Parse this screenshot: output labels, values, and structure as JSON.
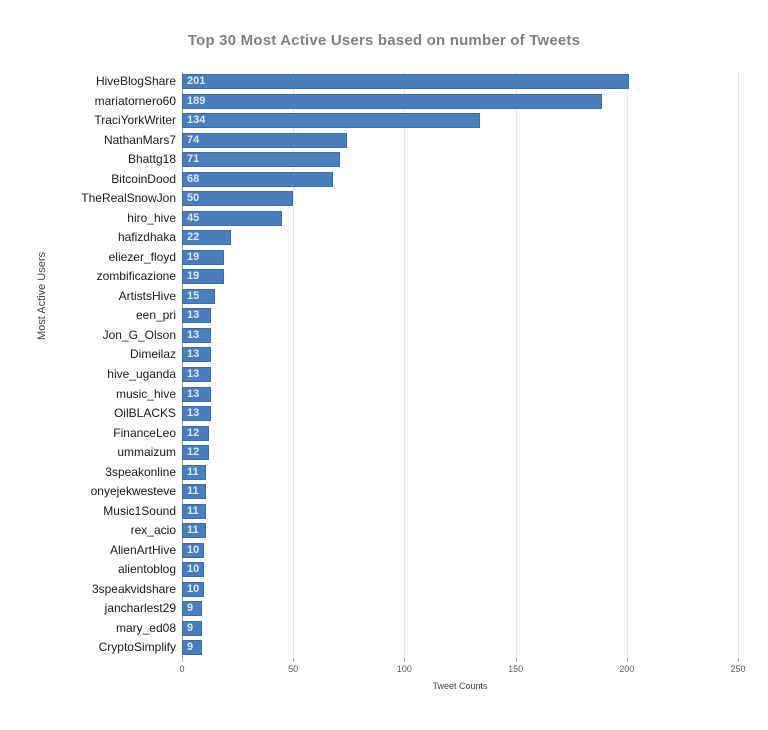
{
  "chart_data": {
    "type": "bar",
    "orientation": "horizontal",
    "title": "Top 30 Most Active Users based on number of Tweets",
    "xlabel": "Tweet Counts",
    "ylabel": "Most Active Users",
    "xlim": [
      0,
      250
    ],
    "xticks": [
      0,
      50,
      100,
      150,
      200,
      250
    ],
    "grid": "vertical",
    "legend": "none",
    "bar_color": "#4a7ebb",
    "label_color": "#dce6f2",
    "categories": [
      "HiveBlogShare",
      "mariatornero60",
      "TraciYorkWriter",
      "NathanMars7",
      "Bhattg18",
      "BitcoinDood",
      "TheRealSnowJon",
      "hiro_hive",
      "hafizdhaka",
      "eliezer_floyd",
      "zombificazione",
      "ArtistsHive",
      "een_pri",
      "Jon_G_Olson",
      "Dimeilaz",
      "hive_uganda",
      "music_hive",
      "OilBLACKS",
      "FinanceLeo",
      "ummaizum",
      "3speakonline",
      "onyejekwesteve",
      "Music1Sound",
      "rex_acio",
      "AlienArtHive",
      "alientoblog",
      "3speakvidshare",
      "jancharlest29",
      "mary_ed08",
      "CryptoSimplify"
    ],
    "values": [
      201,
      189,
      134,
      74,
      71,
      68,
      50,
      45,
      22,
      19,
      19,
      15,
      13,
      13,
      13,
      13,
      13,
      13,
      12,
      12,
      11,
      11,
      11,
      11,
      10,
      10,
      10,
      9,
      9,
      9
    ]
  }
}
